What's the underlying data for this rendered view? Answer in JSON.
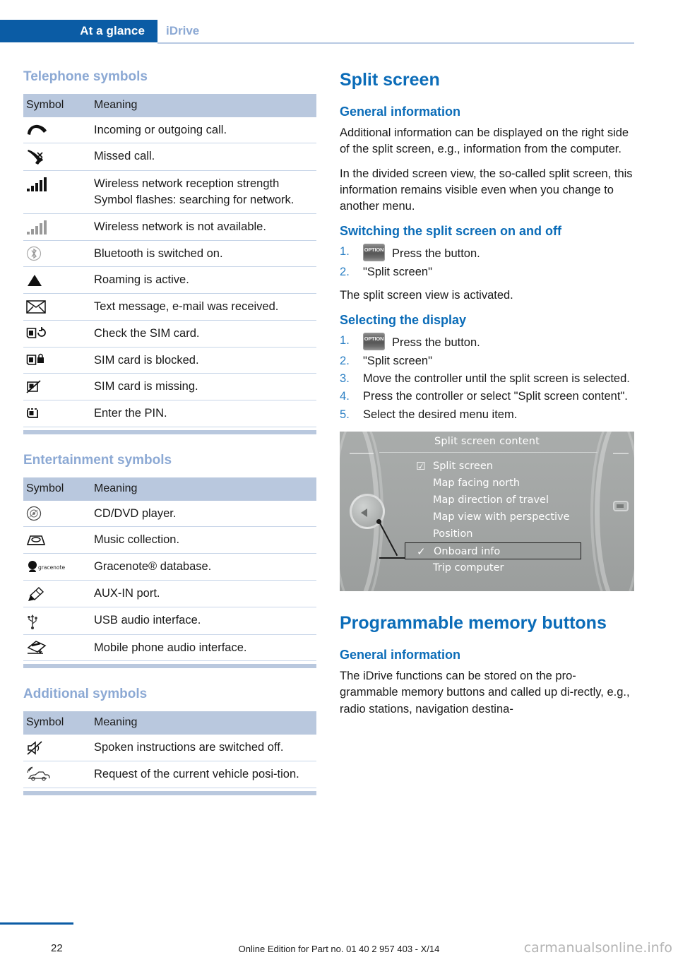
{
  "header": {
    "active_tab": "At a glance",
    "section_tab": "iDrive"
  },
  "left_column": {
    "telephone": {
      "heading": "Telephone symbols",
      "columns": [
        "Symbol",
        "Meaning"
      ],
      "rows": [
        {
          "icon": "phone-handset-icon",
          "meaning": "Incoming or outgoing call."
        },
        {
          "icon": "missed-call-icon",
          "meaning": "Missed call."
        },
        {
          "icon": "signal-bars-icon",
          "meaning": "Wireless network reception strength Symbol flashes: searching for network."
        },
        {
          "icon": "signal-bars-gray-icon",
          "meaning": "Wireless network is not available."
        },
        {
          "icon": "bluetooth-icon",
          "meaning": "Bluetooth is switched on."
        },
        {
          "icon": "roaming-triangle-icon",
          "meaning": "Roaming is active."
        },
        {
          "icon": "envelope-icon",
          "meaning": "Text message, e-mail was received."
        },
        {
          "icon": "sim-check-icon",
          "meaning": "Check the SIM card."
        },
        {
          "icon": "sim-locked-icon",
          "meaning": "SIM card is blocked."
        },
        {
          "icon": "sim-missing-icon",
          "meaning": "SIM card is missing."
        },
        {
          "icon": "sim-pin-icon",
          "meaning": "Enter the PIN."
        }
      ]
    },
    "entertainment": {
      "heading": "Entertainment symbols",
      "columns": [
        "Symbol",
        "Meaning"
      ],
      "rows": [
        {
          "icon": "cd-disc-icon",
          "meaning": "CD/DVD player."
        },
        {
          "icon": "music-collection-icon",
          "meaning": "Music collection."
        },
        {
          "icon": "gracenote-icon",
          "meaning": "Gracenote® database."
        },
        {
          "icon": "aux-plug-icon",
          "meaning": "AUX-IN port."
        },
        {
          "icon": "usb-icon",
          "meaning": "USB audio interface."
        },
        {
          "icon": "mobile-audio-icon",
          "meaning": "Mobile phone audio interface."
        }
      ]
    },
    "additional": {
      "heading": "Additional symbols",
      "columns": [
        "Symbol",
        "Meaning"
      ],
      "rows": [
        {
          "icon": "speaker-muted-icon",
          "meaning": "Spoken instructions are switched off."
        },
        {
          "icon": "vehicle-position-icon",
          "meaning": "Request of the current vehicle posi-tion."
        }
      ]
    }
  },
  "right_column": {
    "split_screen": {
      "title": "Split screen",
      "general_info": {
        "heading": "General information",
        "paragraphs": [
          "Additional information can be displayed on the right side of the split screen, e.g., information from the computer.",
          "In the divided screen view, the so-called split screen, this information remains visible even when you change to another menu."
        ]
      },
      "switching": {
        "heading": "Switching the split screen on and off",
        "steps": [
          {
            "button": "OPTION",
            "text": "Press the button."
          },
          {
            "button": "",
            "text": "\"Split screen\""
          }
        ],
        "result": "The split screen view is activated."
      },
      "selecting": {
        "heading": "Selecting the display",
        "steps": [
          {
            "button": "OPTION",
            "text": "Press the button."
          },
          {
            "button": "",
            "text": "\"Split screen\""
          },
          {
            "button": "",
            "text": "Move the controller until the split screen is selected."
          },
          {
            "button": "",
            "text": "Press the controller or select \"Split screen content\"."
          },
          {
            "button": "",
            "text": "Select the desired menu item."
          }
        ]
      }
    },
    "idrive_screenshot": {
      "title": "Split screen content",
      "items": [
        {
          "label": "Split screen",
          "marker": "checkbox",
          "selected": false
        },
        {
          "label": "Map facing north",
          "marker": "",
          "selected": false
        },
        {
          "label": "Map direction of travel",
          "marker": "",
          "selected": false
        },
        {
          "label": "Map view with perspective",
          "marker": "",
          "selected": false
        },
        {
          "label": "Position",
          "marker": "",
          "selected": false
        },
        {
          "label": "Onboard info",
          "marker": "check",
          "selected": true
        },
        {
          "label": "Trip computer",
          "marker": "",
          "selected": false
        }
      ]
    },
    "memory_buttons": {
      "title": "Programmable memory buttons",
      "general_info": {
        "heading": "General information",
        "paragraphs": [
          "The iDrive functions can be stored on the pro-grammable memory buttons and called up di-rectly, e.g., radio stations, navigation destina-"
        ]
      }
    }
  },
  "footer": {
    "page_number": "22",
    "edition_note": "Online Edition for Part no. 01 40 2 957 403 - X/14",
    "watermark": "carmanualsonline.info"
  },
  "colors": {
    "brand_blue": "#0b5ca5",
    "heading_blue": "#0b6cb8",
    "light_blue_heading": "#8ca9d4",
    "table_header_bg": "#b9c8de",
    "row_divider": "#c7d5e8"
  }
}
